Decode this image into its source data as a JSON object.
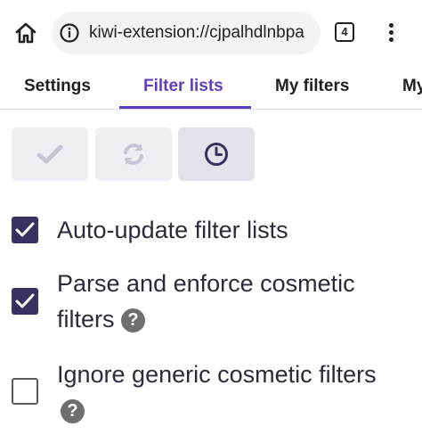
{
  "browser": {
    "url": "kiwi-extension://cjpalhdlnbpa",
    "tab_count": "4"
  },
  "tabs": [
    {
      "label": "Settings",
      "active": false
    },
    {
      "label": "Filter lists",
      "active": true
    },
    {
      "label": "My filters",
      "active": false
    },
    {
      "label": "My",
      "active": false
    }
  ],
  "toolbar": [
    {
      "icon": "check-icon",
      "enabled": false
    },
    {
      "icon": "refresh-icon",
      "enabled": false
    },
    {
      "icon": "clock-icon",
      "enabled": true
    }
  ],
  "options": [
    {
      "label_lines": [
        "Auto-update filter lists"
      ],
      "checked": true,
      "help": false
    },
    {
      "label_lines": [
        "Parse and enforce cosmetic",
        "filters"
      ],
      "checked": true,
      "help": true
    },
    {
      "label_lines": [
        "Ignore generic cosmetic filters",
        ""
      ],
      "checked": false,
      "help": true
    }
  ],
  "help_glyph": "?",
  "colors": {
    "accent": "#5d3fbd",
    "checkbox": "#38305e",
    "button_bg": "#eeeef3"
  }
}
